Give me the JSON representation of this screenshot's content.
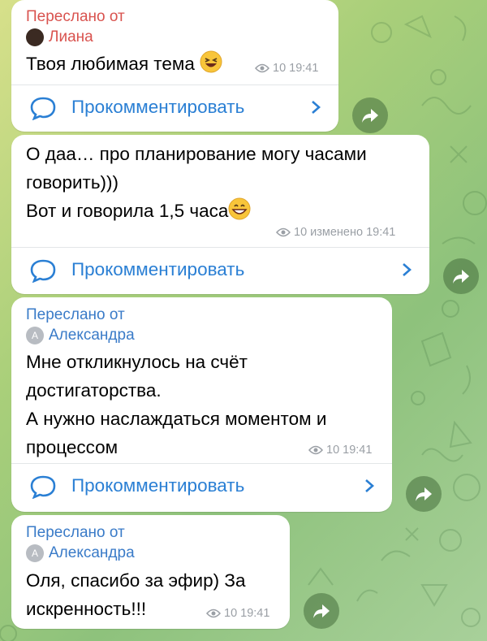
{
  "colors": {
    "forward_label_red": "#d9534f",
    "forward_label_blue": "#3a7bc8",
    "link_blue": "#2a7fd4",
    "meta_gray": "#9a9fa5"
  },
  "comment_label": "Прокомментировать",
  "messages": [
    {
      "forwarded_label": "Переслано от",
      "forwarded_from": "Лиана",
      "text": [
        "Твоя любимая тема"
      ],
      "views": "10",
      "time": "19:41",
      "emoji": "laughing-face"
    },
    {
      "text": [
        "О даа… про планирование могу часами",
        "говорить)))",
        "Вот и говорила 1,5 часа"
      ],
      "views": "10",
      "edited": "изменено",
      "time": "19:41",
      "emoji": "grinning-face"
    },
    {
      "forwarded_label": "Переслано от",
      "forwarded_from": "Александра",
      "avatar_letter": "A",
      "text": [
        "Мне откликнулось на счёт",
        "достигаторства.",
        "А нужно наслаждаться моментом и",
        "процессом"
      ],
      "views": "10",
      "time": "19:41"
    },
    {
      "forwarded_label": "Переслано от",
      "forwarded_from": "Александра",
      "avatar_letter": "A",
      "text": [
        "Оля, спасибо за эфир) За",
        "искренность!!!"
      ],
      "views": "10",
      "time": "19:41"
    }
  ]
}
